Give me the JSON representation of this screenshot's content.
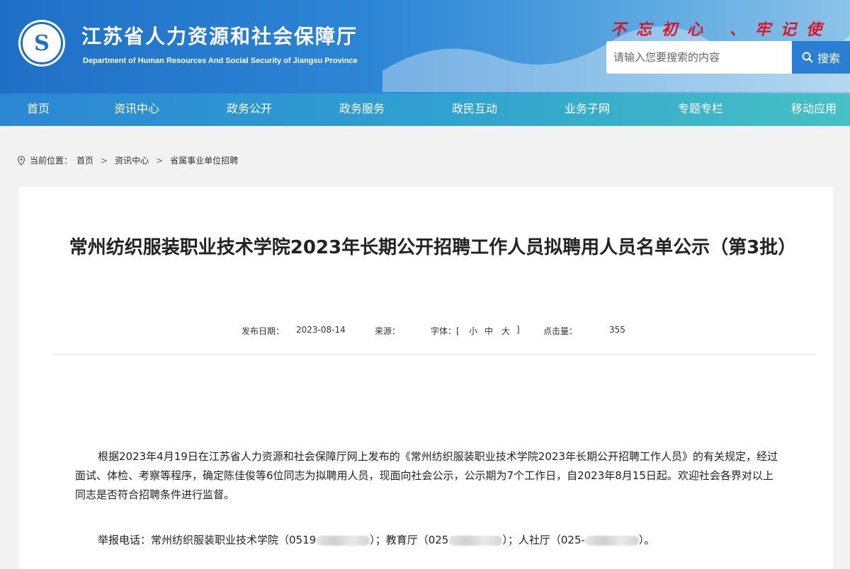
{
  "header": {
    "title": "江苏省人力资源和社会保障厅",
    "subtitle_en": "Department of Human Resources And Social Security of Jiangsu Province",
    "slogan_left": "不忘初心",
    "slogan_right": "、牢记使命",
    "search": {
      "placeholder": "请输入您要搜索的内容",
      "button_label": "搜索"
    }
  },
  "nav": [
    "首页",
    "资讯中心",
    "政务公开",
    "政务服务",
    "政民互动",
    "业务子网",
    "专题专栏",
    "移动应用"
  ],
  "breadcrumb": {
    "prefix": "当前位置：",
    "items": [
      "首页",
      "资讯中心",
      "省属事业单位招聘"
    ]
  },
  "article": {
    "title": "常州纺织服装职业技术学院2023年长期公开招聘工作人员拟聘用人员名单公示（第3批）",
    "meta": {
      "date_label": "发布日期：",
      "date": "2023-08-14",
      "source_label": "来源：",
      "font_label": "字体：[",
      "font_small": "小",
      "font_medium": "中",
      "font_large": "大",
      "font_close": "]",
      "views_label": "点击量：",
      "views": "355"
    },
    "body": "根据2023年4月19日在江苏省人力资源和社会保障厅网上发布的《常州纺织服装职业技术学院2023年长期公开招聘工作人员》的有关规定，经过面试、体检、考察等程序，确定陈佳俊等6位同志为拟聘用人员，现面向社会公示，公示期为7个工作日，自2023年8月15日起。欢迎社会各界对以上同志是否符合招聘条件进行监督。",
    "report": {
      "label": "举报电话：",
      "part1": "常州纺织服装职业技术学院（0519",
      "part1_end": "）；",
      "part2": "教育厅（025",
      "part2_end": "）；",
      "part3": "人社厅（025-",
      "part3_end": "）。"
    }
  },
  "colors": {
    "header_blue": "#1f6fc6",
    "slogan_red": "#d8152a",
    "nav_teal": "#46c1c4"
  }
}
